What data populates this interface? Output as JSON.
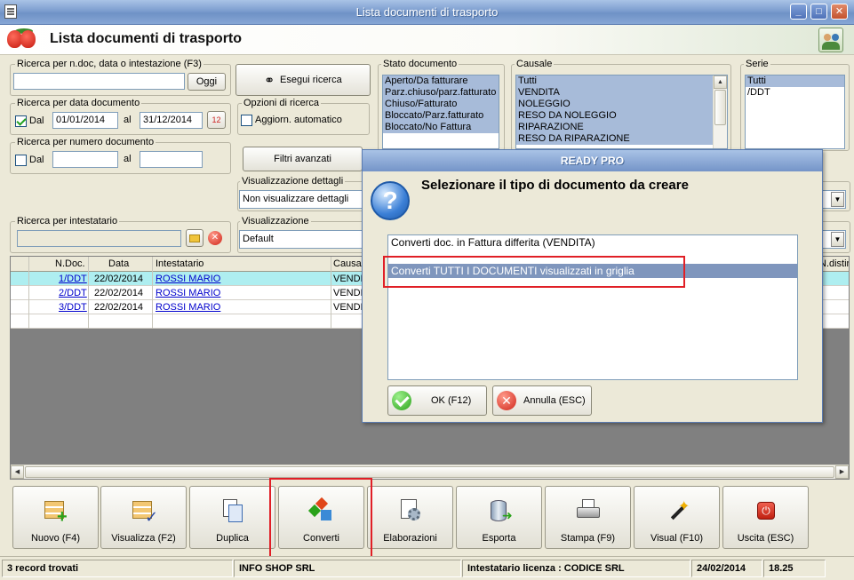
{
  "window": {
    "title": "Lista documenti di trasporto"
  },
  "header": {
    "title": "Lista documenti di trasporto"
  },
  "search": {
    "ndoc_label": "Ricerca per n.doc, data o intestazione (F3)",
    "ndoc_value": "",
    "ogg_button": "Oggi",
    "execute_button": "Esegui ricerca",
    "date_group_label": "Ricerca per data documento",
    "date_dal_label": "Dal",
    "date_from": "01/01/2014",
    "date_al_label": "al",
    "date_to": "31/12/2014",
    "options_label": "Opzioni di ricerca",
    "auto_update_label": "Aggiorn. automatico",
    "num_group_label": "Ricerca per numero documento",
    "num_dal_label": "Dal",
    "num_from": "",
    "num_al_label": "al",
    "num_to": "",
    "advanced_filters": "Filtri avanzati",
    "intestatario_label": "Ricerca per intestatario",
    "intestatario_value": ""
  },
  "visualizzazione_dettagli": {
    "label": "Visualizzazione dettagli",
    "value": "Non visualizzare dettagli"
  },
  "visualizzazione": {
    "label": "Visualizzazione",
    "value": "Default"
  },
  "stato": {
    "label": "Stato documento",
    "items": [
      "Aperto/Da fatturare",
      "Parz.chiuso/parz.fatturato",
      "Chiuso/Fatturato",
      "Bloccato/Parz.fatturato",
      "Bloccato/No Fattura"
    ]
  },
  "causale": {
    "label": "Causale",
    "items": [
      "Tutti",
      "VENDITA",
      "NOLEGGIO",
      "RESO DA NOLEGGIO",
      "RIPARAZIONE",
      "RESO DA RIPARAZIONE"
    ]
  },
  "serie": {
    "label": "Serie",
    "items": [
      "Tutti",
      "/DDT"
    ]
  },
  "grid": {
    "columns": [
      "N.Doc.",
      "Data",
      "Intestatario",
      "Causal",
      "N.distin"
    ],
    "rows": [
      {
        "ndoc": "1/DDT",
        "data": "22/02/2014",
        "intestatario": "ROSSI MARIO",
        "causale": "VENDI"
      },
      {
        "ndoc": "2/DDT",
        "data": "22/02/2014",
        "intestatario": "ROSSI MARIO",
        "causale": "VENDI"
      },
      {
        "ndoc": "3/DDT",
        "data": "22/02/2014",
        "intestatario": "ROSSI MARIO",
        "causale": "VENDI"
      }
    ]
  },
  "toolbar": {
    "nuovo": "Nuovo (F4)",
    "visualizza": "Visualizza (F2)",
    "duplica": "Duplica",
    "converti": "Converti",
    "elaborazioni": "Elaborazioni",
    "esporta": "Esporta",
    "stampa": "Stampa (F9)",
    "visual": "Visual (F10)",
    "uscita": "Uscita (ESC)"
  },
  "status": {
    "records": "3 record trovati",
    "company": "INFO SHOP SRL",
    "license": "Intestatario licenza : CODICE SRL",
    "date": "24/02/2014",
    "time": "18.25"
  },
  "dialog": {
    "title": "READY PRO",
    "message": "Selezionare il tipo di documento da creare",
    "options": [
      "Converti doc. in Fattura differita (VENDITA)",
      "Converti TUTTI I DOCUMENTI visualizzati in griglia"
    ],
    "ok_button": "OK (F12)",
    "cancel_button": "Annulla (ESC)"
  },
  "colors": {
    "highlight_box": "#e01f26",
    "title_bar": "#7d9ecf",
    "selected_row": "#aeeef0"
  }
}
